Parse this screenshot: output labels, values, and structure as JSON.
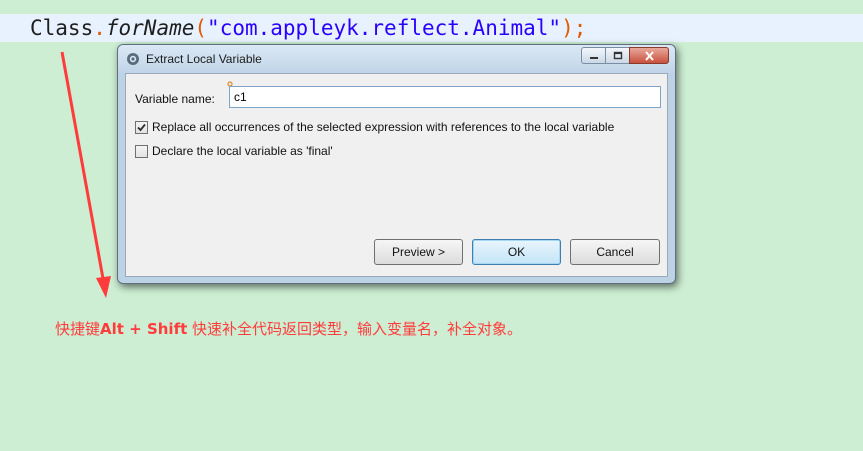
{
  "editor": {
    "code": {
      "class_token": "Class",
      "dot": ".",
      "method": "forName",
      "open_paren": "(",
      "string_literal": "\"com.appleyk.reflect.Animal\"",
      "close_paren_semi": ");"
    }
  },
  "dialog": {
    "title": "Extract Local Variable",
    "window_buttons": [
      "minimize",
      "restore",
      "close"
    ],
    "variable_name_label": "Variable name:",
    "variable_name_value": "c1",
    "options": [
      {
        "label": "Replace all occurrences of the selected expression with references to the local variable",
        "checked": true
      },
      {
        "label": "Declare the local variable as 'final'",
        "checked": false
      }
    ],
    "buttons": {
      "preview": "Preview >",
      "ok": "OK",
      "cancel": "Cancel"
    }
  },
  "annotation": {
    "prefix": "快捷键",
    "shortcut": "Alt + Shift",
    "suffix": " 快速补全代码返回类型，输入变量名，补全对象。"
  },
  "colors": {
    "background": "#cdeed3",
    "annotation": "#ff3b3b",
    "highlight_line": "#e8f2fe"
  }
}
